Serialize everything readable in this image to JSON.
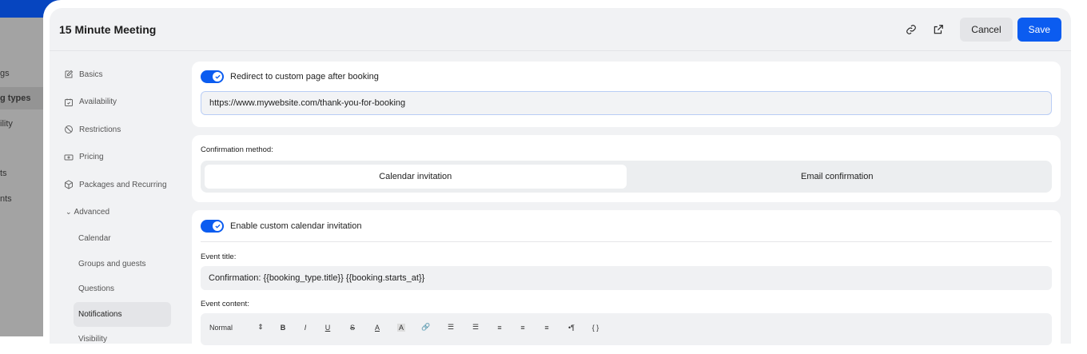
{
  "backdrop": {
    "items": [
      "gs",
      "g types",
      "ility",
      "ts",
      "nts"
    ]
  },
  "header": {
    "title": "15 Minute Meeting",
    "cancel": "Cancel",
    "save": "Save"
  },
  "nav": {
    "items": [
      "Basics",
      "Availability",
      "Restrictions",
      "Pricing",
      "Packages and Recurring"
    ],
    "advanced": "Advanced",
    "sub": [
      "Calendar",
      "Groups and guests",
      "Questions",
      "Notifications",
      "Visibility"
    ]
  },
  "redirect": {
    "label": "Redirect to custom page after booking",
    "url": "https://www.mywebsite.com/thank-you-for-booking"
  },
  "confirmation": {
    "label": "Confirmation method:",
    "options": [
      "Calendar invitation",
      "Email confirmation"
    ]
  },
  "invitation": {
    "label": "Enable custom calendar invitation",
    "event_title_label": "Event title:",
    "event_title": "Confirmation: {{booking_type.title}} {{booking.starts_at}}",
    "event_content_label": "Event content:"
  },
  "toolbar": {
    "format": "Normal",
    "bold": "B",
    "italic": "I",
    "underline": "U",
    "strike": "S",
    "color": "A",
    "bg": "A",
    "link": "🔗",
    "ol": "☰",
    "ul": "☰",
    "left": "≡",
    "center": "≡",
    "right": "≡",
    "rtl": "•¶",
    "vars": "{ }"
  },
  "colors": {
    "accent": "#0b5cf0"
  }
}
